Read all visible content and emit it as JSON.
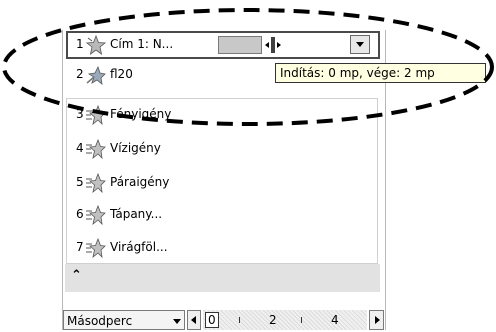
{
  "animation_list": {
    "items": [
      {
        "number": "1",
        "label": "Cím 1: N...",
        "icon": "star-effect-icon",
        "selected": true
      },
      {
        "number": "2",
        "label": "fl20",
        "icon": "star-effect-icon"
      },
      {
        "number": "3",
        "label": "Fényigény",
        "icon": "star-effect-icon"
      },
      {
        "number": "4",
        "label": "Vízigény",
        "icon": "star-effect-icon"
      },
      {
        "number": "5",
        "label": "Páraigény",
        "icon": "star-effect-icon"
      },
      {
        "number": "6",
        "label": "Tápany...",
        "icon": "star-effect-icon"
      },
      {
        "number": "7",
        "label": "Virágföl...",
        "icon": "star-effect-icon"
      }
    ],
    "scroll_up_glyph": "»"
  },
  "tooltip": {
    "text": "Indítás: 0 mp, vége: 2 mp"
  },
  "timeline": {
    "units_label": "Másodperc",
    "ticks": [
      "0",
      "2",
      "4"
    ]
  }
}
